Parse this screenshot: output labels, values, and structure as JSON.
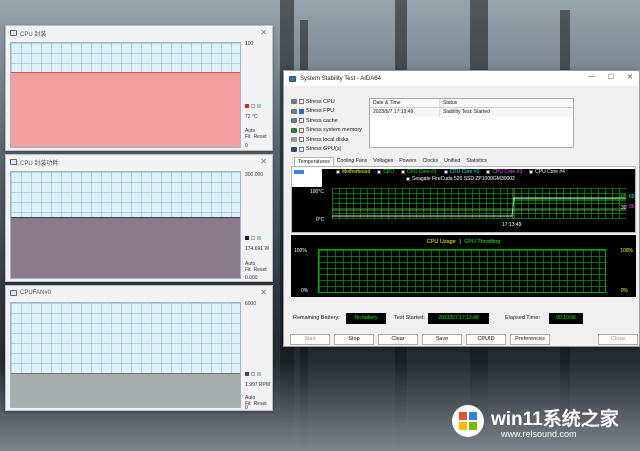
{
  "sensor_windows": [
    {
      "title": "CPU 封装",
      "max": "100",
      "reading": "72 °C",
      "auto_fit": "Auto Fit",
      "reset": "Reset",
      "min": "0",
      "color": "#f08080",
      "level": 0.72
    },
    {
      "title": "CPU 封装功耗",
      "max": "300.000",
      "reading": "174.691 W",
      "auto_fit": "Auto Fit",
      "reset": "Reset",
      "min": "0.000",
      "color": "#7f6f7e",
      "level": 0.58
    },
    {
      "title": "CPUFAN#0",
      "max": "6000",
      "reading": "1.997 RPM",
      "auto_fit": "Auto Fit",
      "reset": "Reset",
      "min": "0",
      "color": "#9aa3a3",
      "level": 0.33
    }
  ],
  "aida": {
    "title": "System Stability Test - AIDA64",
    "stress_items": [
      {
        "label": "Stress CPU",
        "checked": false
      },
      {
        "label": "Stress FPU",
        "checked": true
      },
      {
        "label": "Stress cache",
        "checked": false
      },
      {
        "label": "Stress system memory",
        "checked": false
      },
      {
        "label": "Stress local disks",
        "checked": false
      },
      {
        "label": "Stress GPU(s)",
        "checked": false
      }
    ],
    "log": {
      "col_date": "Date & Time",
      "col_status": "Status",
      "rows": [
        {
          "date": "2023/5/7 17:13:49",
          "status": "Stability Test: Started"
        }
      ]
    },
    "tabs": [
      "Temperatures",
      "Cooling Fans",
      "Voltages",
      "Powers",
      "Clocks",
      "Unified",
      "Statistics"
    ],
    "legend": [
      {
        "label": "Motherboard",
        "color": "#ffff00"
      },
      {
        "label": "CPU",
        "color": "#00ff00"
      },
      {
        "label": "CPU Core #1",
        "color": "#00ff00"
      },
      {
        "label": "CPU Core #2",
        "color": "#00ffff"
      },
      {
        "label": "CPU Core #3",
        "color": "#ff55ff"
      },
      {
        "label": "CPU Core #4",
        "color": "#ffffff"
      },
      {
        "label": "Seagate FireCuda 520 SSD ZP1000GM30002",
        "color": "#ffffff"
      }
    ],
    "temp_chart": {
      "ymax": "100°C",
      "ymin": "0°C",
      "time": "17:13:49",
      "val1": "69",
      "val2": "65",
      "val3": "30",
      "val4": "36"
    },
    "cpu_chart": {
      "label_usage": "CPU Usage",
      "sep": "|",
      "label_throttle": "CPU Throttling",
      "left_max": "100%",
      "left_min": "0%",
      "right_max": "100%",
      "right_min": "0%"
    },
    "status": {
      "battery_label": "Remaining Battery:",
      "battery_value": "No battery",
      "started_label": "Test Started:",
      "started_value": "2023/5/7 17:13:49",
      "elapsed_label": "Elapsed Time:",
      "elapsed_value": "00:10:06"
    },
    "buttons": {
      "start": "Start",
      "stop": "Stop",
      "clear": "Clear",
      "save": "Save",
      "cpuid": "CPUID",
      "preferences": "Preferences",
      "close": "Close"
    }
  },
  "watermark": {
    "title": "win11系统之家",
    "url": "www.relsound.com"
  }
}
